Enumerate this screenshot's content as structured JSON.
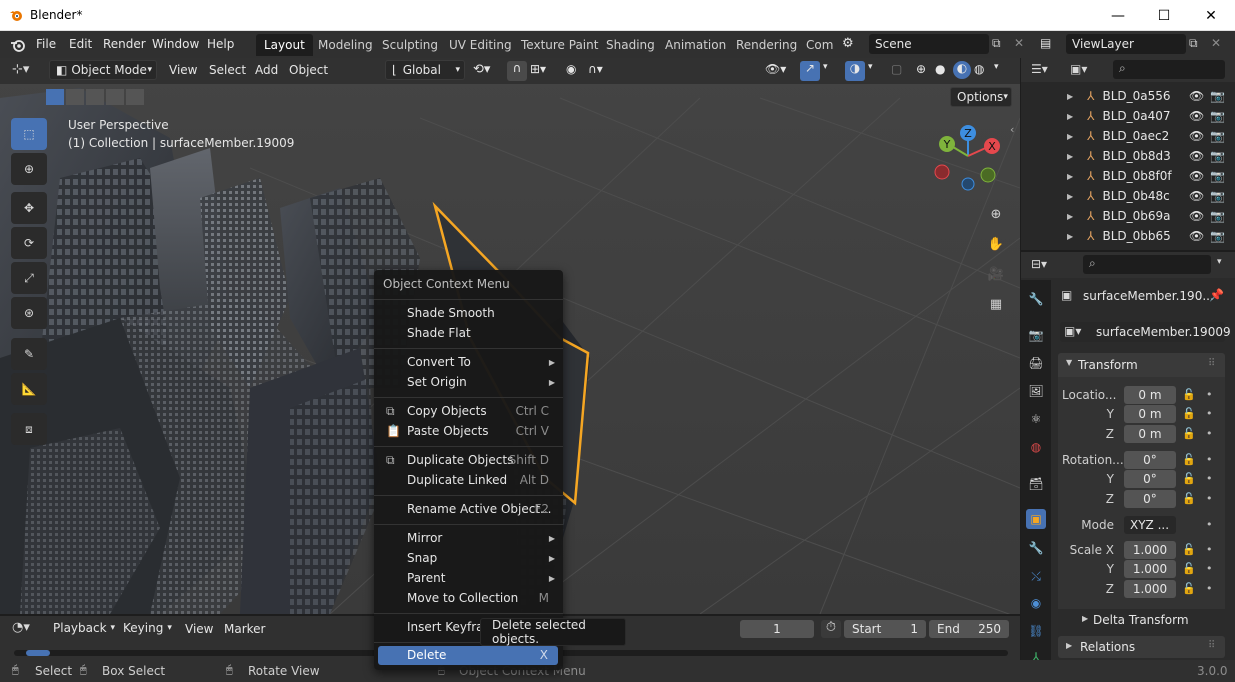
{
  "window": {
    "title": "Blender*",
    "minimize": "—",
    "maximize": "☐",
    "close": "✕"
  },
  "menu": {
    "items": [
      "File",
      "Edit",
      "Render",
      "Window",
      "Help"
    ]
  },
  "workspaces": {
    "tabs": [
      "Layout",
      "Modeling",
      "Sculpting",
      "UV Editing",
      "Texture Paint",
      "Shading",
      "Animation",
      "Rendering",
      "Com"
    ],
    "active": "Layout"
  },
  "scene": {
    "name": "Scene"
  },
  "viewlayer": {
    "name": "ViewLayer"
  },
  "viewport": {
    "mode": "Object Mode",
    "menus": [
      "View",
      "Select",
      "Add",
      "Object"
    ],
    "transform_orientation": "Global",
    "options_label": "Options",
    "perspective_label": "User Perspective",
    "collection_label": "(1) Collection | surfaceMember.19009",
    "gizmo_axes": {
      "x": "X",
      "y": "Y",
      "z": "Z"
    }
  },
  "outliner": {
    "items": [
      "BLD_0a556",
      "BLD_0a407",
      "BLD_0aec2",
      "BLD_0b8d3",
      "BLD_0b8f0f",
      "BLD_0b48c",
      "BLD_0b69a",
      "BLD_0bb65"
    ]
  },
  "properties": {
    "object_name": "surfaceMember.190...",
    "data_name": "surfaceMember.19009",
    "transform_title": "Transform",
    "location_label": "Locatio...",
    "location": {
      "x": "0 m",
      "y": "0 m",
      "z": "0 m"
    },
    "rotation_label": "Rotation...",
    "rotation": {
      "x": "0°",
      "y": "0°",
      "z": "0°"
    },
    "mode_label": "Mode",
    "mode_value": "XYZ ...",
    "scale_label": "Scale X",
    "scale": {
      "x": "1.000",
      "y": "1.000",
      "z": "1.000"
    },
    "axis_y": "Y",
    "axis_z": "Z",
    "delta_title": "Delta Transform",
    "relations_title": "Relations"
  },
  "timeline": {
    "menus": [
      "Playback",
      "Keying",
      "View",
      "Marker"
    ],
    "current_frame": "1",
    "start_label": "Start",
    "start_value": "1",
    "end_label": "End",
    "end_value": "250"
  },
  "context_menu": {
    "title": "Object Context Menu",
    "items": [
      {
        "label": "Shade Smooth",
        "shortcut": "",
        "submenu": false
      },
      {
        "label": "Shade Flat",
        "shortcut": "",
        "submenu": false
      },
      {
        "label": "Convert To",
        "shortcut": "",
        "submenu": true
      },
      {
        "label": "Set Origin",
        "shortcut": "",
        "submenu": true
      },
      {
        "label": "Copy Objects",
        "shortcut": "Ctrl C",
        "submenu": false
      },
      {
        "label": "Paste Objects",
        "shortcut": "Ctrl V",
        "submenu": false
      },
      {
        "label": "Duplicate Objects",
        "shortcut": "Shift D",
        "submenu": false
      },
      {
        "label": "Duplicate Linked",
        "shortcut": "Alt D",
        "submenu": false
      },
      {
        "label": "Rename Active Object...",
        "shortcut": "F2",
        "submenu": false
      },
      {
        "label": "Mirror",
        "shortcut": "",
        "submenu": true
      },
      {
        "label": "Snap",
        "shortcut": "",
        "submenu": true
      },
      {
        "label": "Parent",
        "shortcut": "",
        "submenu": true
      },
      {
        "label": "Move to Collection",
        "shortcut": "M",
        "submenu": false
      },
      {
        "label": "Insert Keyfram",
        "shortcut": "",
        "submenu": false
      },
      {
        "label": "Delete",
        "shortcut": "X",
        "submenu": false
      }
    ],
    "highlighted": "Delete"
  },
  "tooltip": {
    "text": "Delete selected objects."
  },
  "statusbar": {
    "select": "Select",
    "box_select": "Box Select",
    "rotate_view": "Rotate View",
    "context_menu": "Object Context Menu",
    "version": "3.0.0"
  },
  "colors": {
    "accent": "#4772b3",
    "selection_outline": "#f5a623",
    "axis_x": "#e5484d",
    "axis_y": "#7fb33c",
    "axis_z": "#3d8ee0"
  }
}
